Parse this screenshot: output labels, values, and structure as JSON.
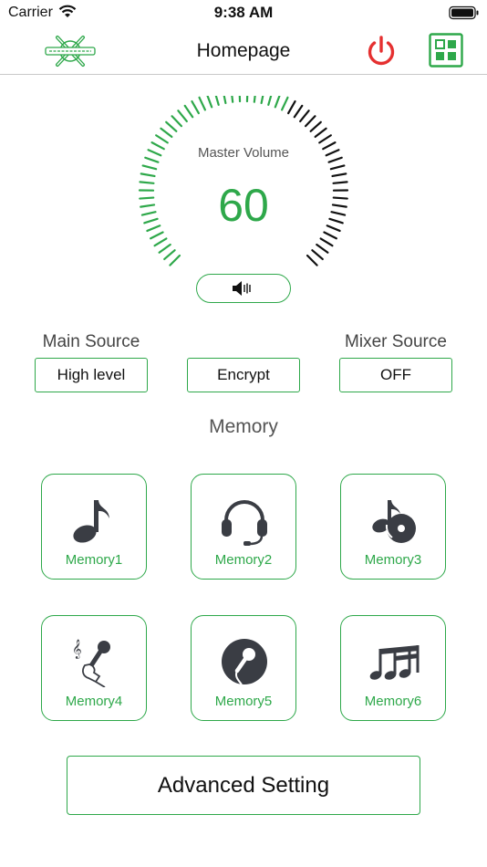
{
  "status": {
    "carrier": "Carrier",
    "time": "9:38 AM"
  },
  "header": {
    "title": "Homepage",
    "power_color": "#e53030",
    "accent": "#2ea84a"
  },
  "volume": {
    "label": "Master Volume",
    "value": "60",
    "level_percent": 60
  },
  "sources": {
    "main_label": "Main Source",
    "main_value": "High level",
    "middle_value": "Encrypt",
    "mixer_label": "Mixer Source",
    "mixer_value": "OFF"
  },
  "memory": {
    "title": "Memory",
    "items": [
      {
        "label": "Memory1",
        "icon": "music-note-icon"
      },
      {
        "label": "Memory2",
        "icon": "headset-icon"
      },
      {
        "label": "Memory3",
        "icon": "note-disc-icon"
      },
      {
        "label": "Memory4",
        "icon": "hand-microphone-icon"
      },
      {
        "label": "Memory5",
        "icon": "microphone-circle-icon"
      },
      {
        "label": "Memory6",
        "icon": "sixteenth-notes-icon"
      }
    ]
  },
  "advanced": {
    "label": "Advanced Setting"
  }
}
